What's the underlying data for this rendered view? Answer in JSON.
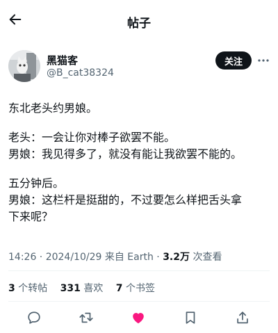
{
  "header": {
    "title": "帖子",
    "back_icon": "arrow-left-icon"
  },
  "author": {
    "display_name": "黑猫客",
    "handle": "@B_cat38324",
    "follow_label": "关注",
    "more_icon": "more-horizontal-icon"
  },
  "post": {
    "paragraphs": [
      [
        "东北老头约男娘。"
      ],
      [
        "老头：一会让你对棒子欲罢不能。",
        "男娘：我见得多了，就没有能让我欲罢不能的。"
      ],
      [
        "五分钟后。",
        "男娘：这栏杆是挺甜的，不过要怎么样把舌头拿",
        "下来呢？"
      ]
    ]
  },
  "meta": {
    "timestamp": "14:26 · 2024/10/29 来自 Earth · ",
    "views_count": "3.2万",
    "views_label": " 次查看"
  },
  "stats": {
    "reposts_count": "3",
    "reposts_label": " 个转帖",
    "likes_count": "331",
    "likes_label": " 喜欢",
    "bookmarks_count": "7",
    "bookmarks_label": " 个书签"
  },
  "actions": {
    "reply_icon": "reply-icon",
    "repost_icon": "repost-icon",
    "like_icon": "heart-icon",
    "bookmark_icon": "bookmark-icon",
    "share_icon": "share-icon"
  },
  "colors": {
    "text": "#0f1419",
    "muted": "#536471",
    "divider": "#eff3f4",
    "like_active": "#f91880",
    "follow_bg": "#0f1419"
  }
}
